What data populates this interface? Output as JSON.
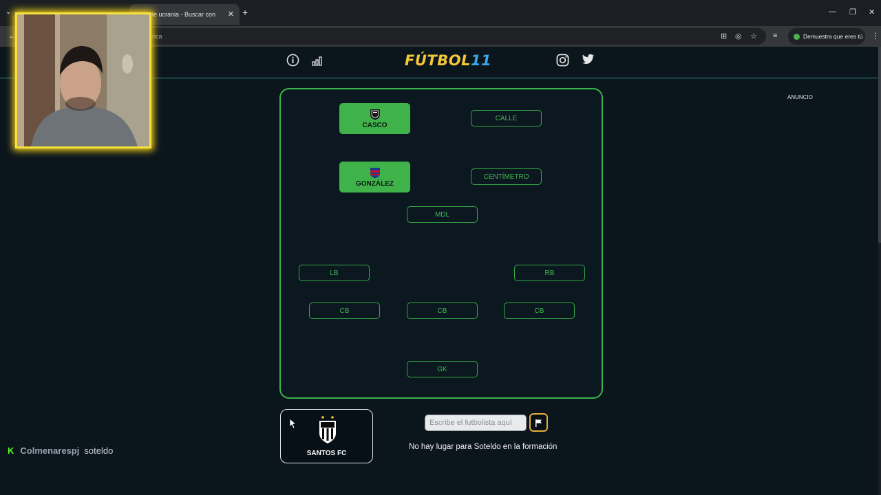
{
  "browser": {
    "tabs": [
      {
        "label": "",
        "active": false
      },
      {
        "label": "ntral de ucrania - Buscar con",
        "active": true
      }
    ],
    "new_tab": "+",
    "address": "erica",
    "profile_label": "Demuestra que eres tú"
  },
  "site": {
    "logo_text": "FÚTBOL",
    "logo_number": "11",
    "icons": [
      "info-icon",
      "stats-icon",
      "instagram-icon",
      "twitter-icon"
    ],
    "ad_label": "ANUNCIO"
  },
  "formation": {
    "slots": [
      {
        "label": "CASCO",
        "filled": true,
        "crest": "atletico-mineiro"
      },
      {
        "label": "CALLE",
        "filled": false
      },
      {
        "label": "GONZÁLEZ",
        "filled": true,
        "crest": "san-lorenzo"
      },
      {
        "label": "CENTÍMETRO",
        "filled": false
      },
      {
        "label": "MDL",
        "filled": false
      },
      {
        "label": "LB",
        "filled": false
      },
      {
        "label": "RB",
        "filled": false
      },
      {
        "label": "CB",
        "filled": false
      },
      {
        "label": "CB",
        "filled": false
      },
      {
        "label": "CB",
        "filled": false
      },
      {
        "label": "GK",
        "filled": false
      }
    ]
  },
  "club_card": {
    "name": "SANTOS FC"
  },
  "search": {
    "placeholder": "Escribe el futbolista aquí"
  },
  "message": "No hay lugar para Soteldo en la formación",
  "chat": {
    "badge": "K",
    "user": "Colmenarespj",
    "text": "soteldo"
  },
  "colors": {
    "pitch_green": "#3bb34a",
    "logo_gold": "#f3c73a",
    "logo_blue": "#3aa6e8",
    "flag_border": "#e6b13a"
  }
}
